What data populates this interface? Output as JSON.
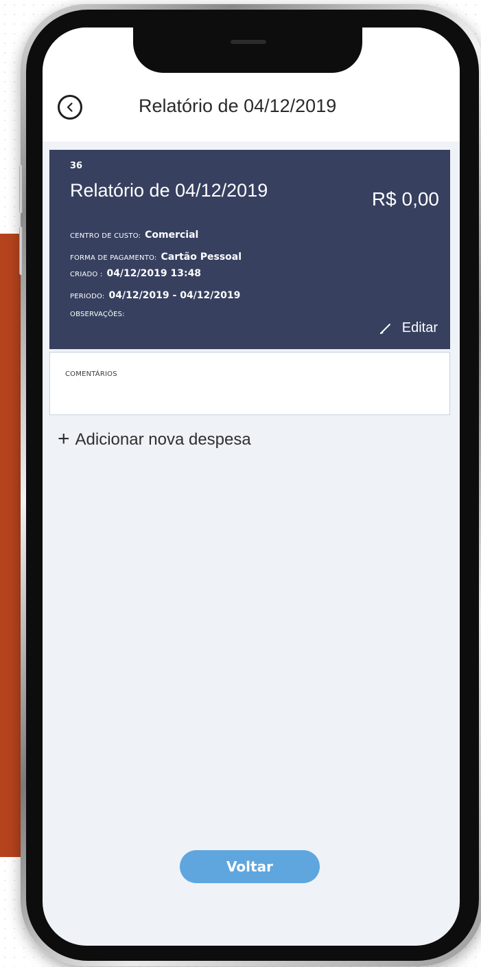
{
  "header": {
    "back_icon": "chevron-left-circle-icon",
    "title": "Relatório de 04/12/2019"
  },
  "report": {
    "number": "36",
    "title": "Relatório de 04/12/2019",
    "amount": "R$ 0,00",
    "fields": {
      "cost_center": {
        "label": "Centro de Custo:",
        "value": "Comercial"
      },
      "payment_method": {
        "label": "Forma de Pagamento:",
        "value": "Cartão Pessoal"
      },
      "created": {
        "label": "Criado :",
        "value": "04/12/2019 13:48"
      },
      "period": {
        "label": "Periodo:",
        "value": "04/12/2019 - 04/12/2019"
      },
      "notes": {
        "label": "Observações:",
        "value": ""
      }
    },
    "edit_label": "Editar",
    "edit_icon": "pencil-icon"
  },
  "comments": {
    "label": "Comentários"
  },
  "actions": {
    "add_expense_label": "Adicionar nova despesa",
    "add_icon": "plus-icon",
    "back_button_label": "Voltar"
  },
  "colors": {
    "card_background": "#37405f",
    "primary_button": "#5fa6de",
    "screen_background": "#eff2f6",
    "accent_block": "#b5441e"
  }
}
